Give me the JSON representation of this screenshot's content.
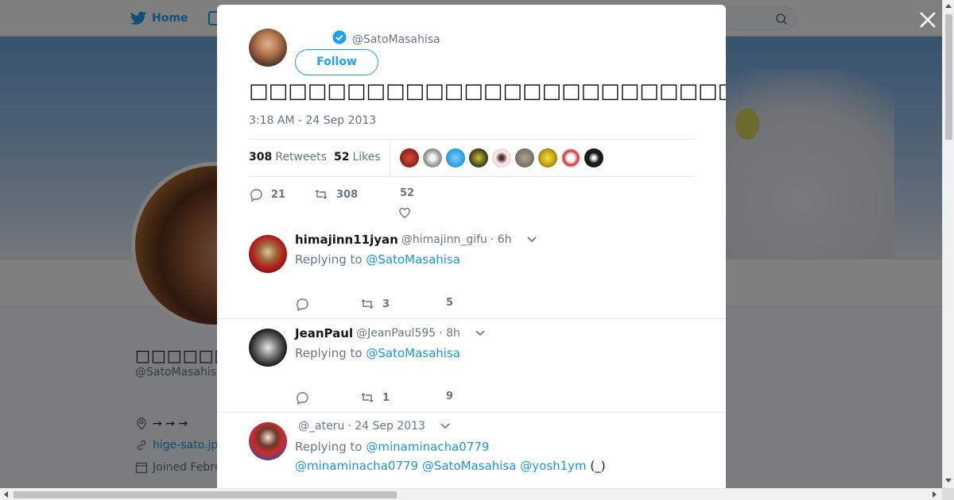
{
  "colors": {
    "accent": "#1da1f2",
    "link": "#1b95e0",
    "text": "#14171a",
    "muted": "#657786"
  },
  "background": {
    "home_label": "Home",
    "profile_name": "□□□□□□□□□",
    "profile_handle": "@SatoMasahisa",
    "location": "→ → →",
    "website": "hige-sato.jp",
    "joined": "Joined Febru"
  },
  "tweet": {
    "handle": "@SatoMasahisa",
    "follow_label": "Follow",
    "text": "□□□□□□□□□□□□□□□□□□□□□□□□□□□□□□□□□□□□□□□□□□□□□□□□□□",
    "timestamp": "3:18 AM - 24 Sep 2013",
    "retweets_count": "308",
    "retweets_label": "Retweets",
    "likes_count": "52",
    "likes_label": "Likes",
    "reply_count": "21",
    "retweet_action_count": "308",
    "like_action_count": "52"
  },
  "replies": [
    {
      "name": "himajinn11jyan",
      "handle": "@himajinn_gifu",
      "time": "· 6h",
      "replying_label": "Replying to",
      "replying_to": "@SatoMasahisa",
      "body": "",
      "retweets": "3",
      "likes": "5"
    },
    {
      "name": "JeanPaul",
      "handle": "@JeanPaul595",
      "time": "· 8h",
      "replying_label": "Replying to",
      "replying_to": "@SatoMasahisa",
      "body": "",
      "retweets": "1",
      "likes": "9"
    },
    {
      "name": "",
      "handle": "@_ateru",
      "time": "· 24 Sep 2013",
      "replying_label": "Replying to",
      "replying_to": "@minaminacha0779",
      "body_links": "@minaminacha0779 @SatoMasahisa @yosh1ym",
      "body_text": " (_)"
    }
  ]
}
